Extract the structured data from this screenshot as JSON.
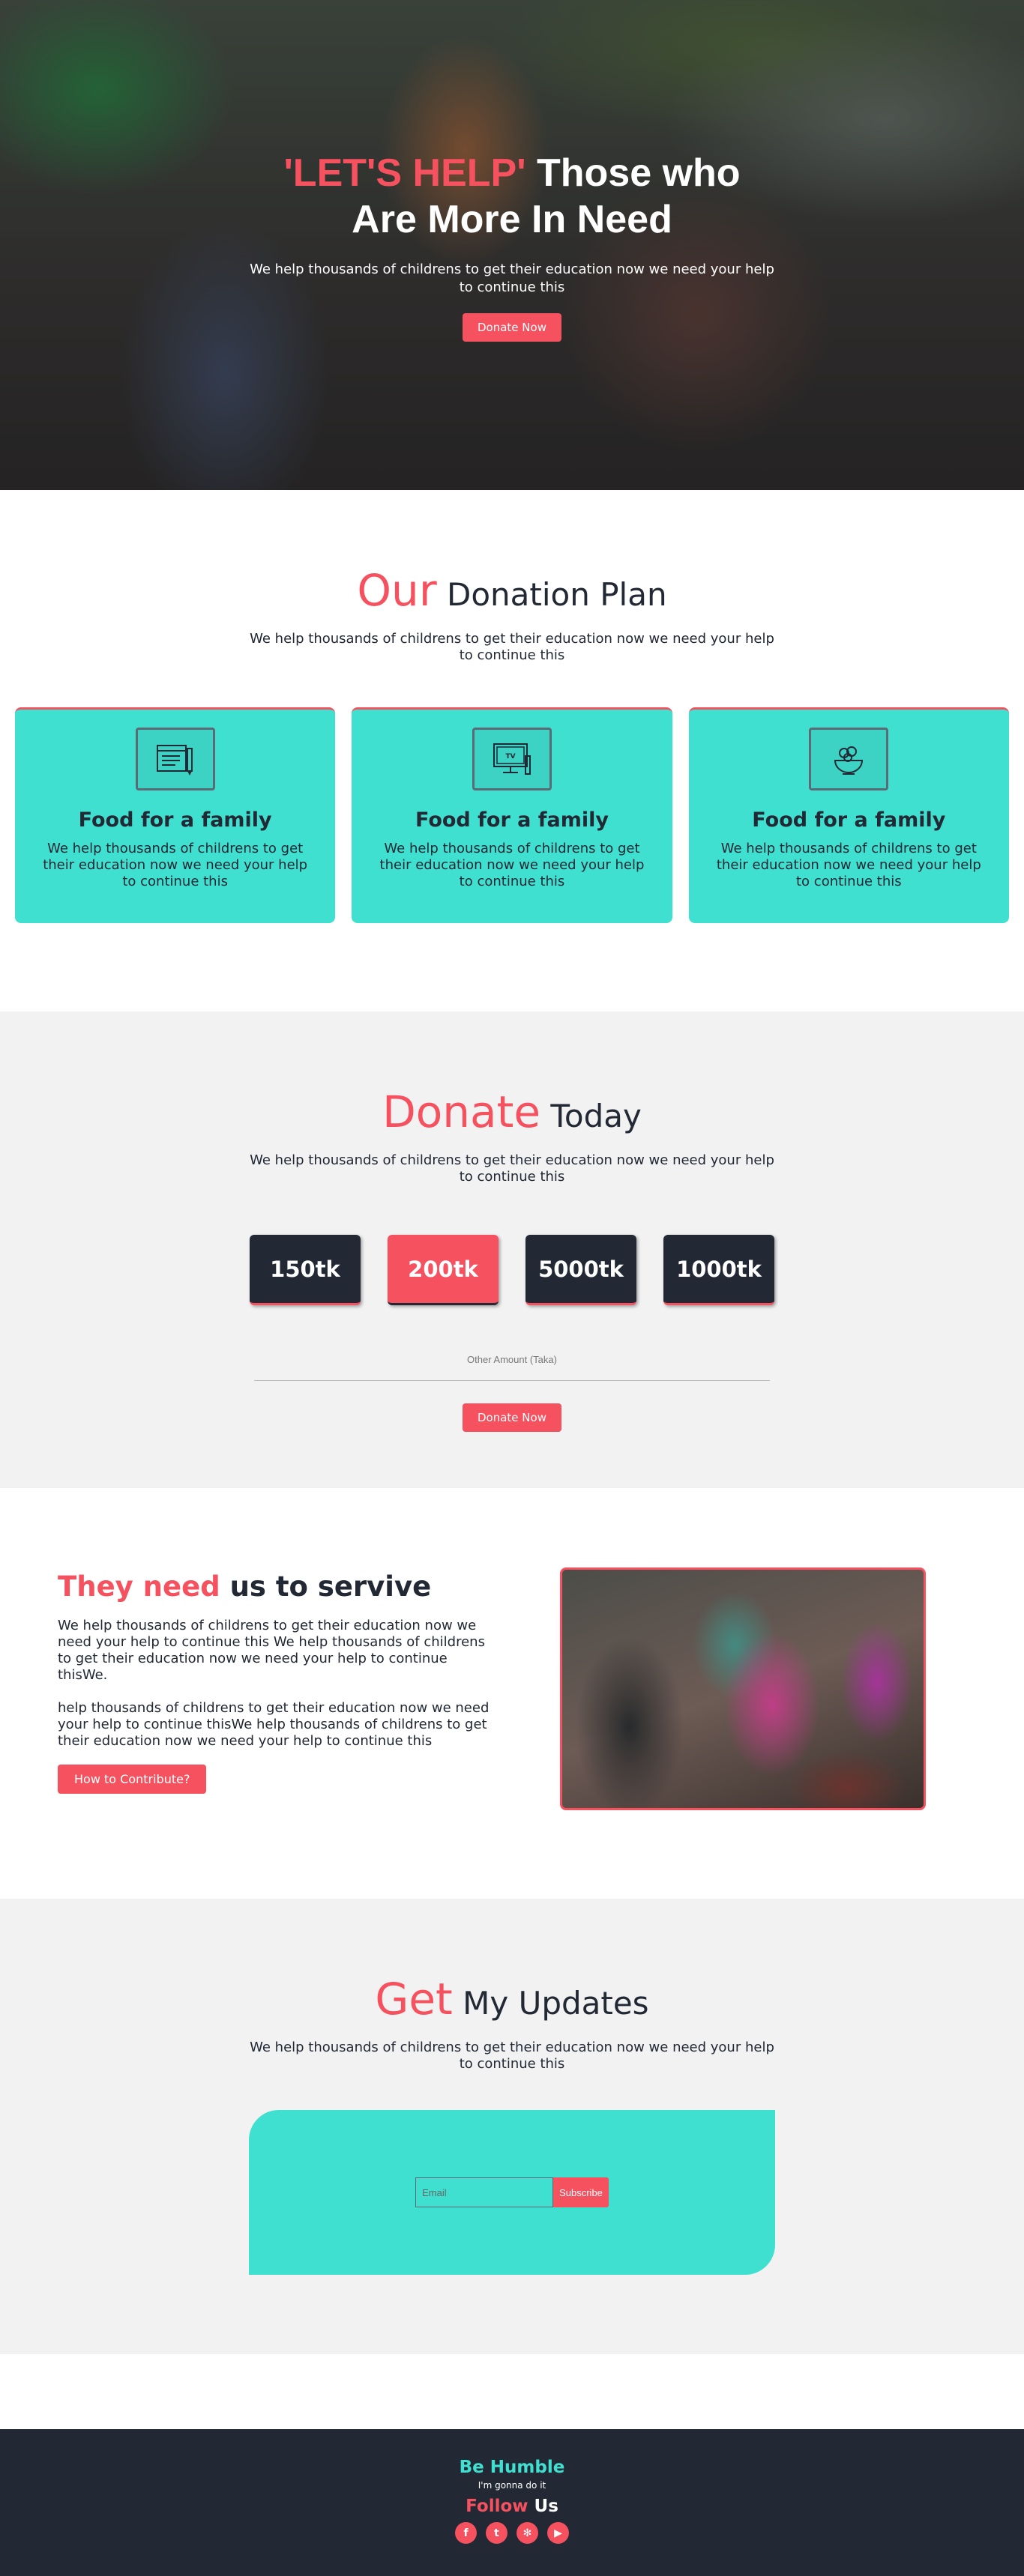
{
  "hero": {
    "title_accent": "'LET'S HELP'",
    "title_rest": " Those who",
    "title_line2": "Are More In Need",
    "subtitle": "We help thousands of childrens to get their education now we need your help to continue this",
    "button": "Donate Now"
  },
  "plan": {
    "title_accent": "Our",
    "title_rest": " Donation Plan",
    "subtitle": "We help thousands of childrens to get their education now we need your help to continue this",
    "cards": [
      {
        "icon": "document-pencil-icon",
        "title": "Food for a family",
        "text": "We help thousands of childrens to get their education now we need your help to continue this"
      },
      {
        "icon": "tv-icon",
        "icon_label": "TV",
        "title": "Food for a family",
        "text": "We help thousands of childrens to get their education now we need your help to continue this"
      },
      {
        "icon": "food-bowl-icon",
        "title": "Food for a family",
        "text": "We help thousands of childrens to get their education now we need your help to continue this"
      }
    ]
  },
  "donate": {
    "title_accent": "Donate",
    "title_rest": " Today",
    "subtitle": "We help thousands of childrens to get their education now we need your help to continue this",
    "amounts": [
      "150tk",
      "200tk",
      "5000tk",
      "1000tk"
    ],
    "selected": "200tk",
    "other_label": "Other Amount (Taka)",
    "button": "Donate Now"
  },
  "survive": {
    "title_accent": "They need",
    "title_rest": " us to servive",
    "para1": "We help thousands of childrens to get their education now we need your help to continue this We help thousands of childrens to get their education now we need your help to continue thisWe.",
    "para2": "help thousands of childrens to get their education now we need your help to continue thisWe help thousands of childrens to get their education now we need your help to continue this",
    "button": "How to Contribute?"
  },
  "updates": {
    "title_accent": "Get",
    "title_rest": " My Updates",
    "subtitle": "We help thousands of childrens to get their education now we need your help to continue this",
    "email_placeholder": "Email",
    "subscribe": "Subscribe"
  },
  "footer": {
    "brand": "Be Humble",
    "tagline": "I'm gonna do it",
    "follow_accent": "Follow",
    "follow_rest": " Us",
    "socials": [
      {
        "icon": "facebook-icon",
        "glyph": "f"
      },
      {
        "icon": "twitter-icon",
        "glyph": "t"
      },
      {
        "icon": "yelp-icon",
        "glyph": "✻"
      },
      {
        "icon": "youtube-icon",
        "glyph": "▶"
      }
    ]
  },
  "colors": {
    "accent": "#f5515f",
    "teal": "#40e0d0",
    "dark": "#222834",
    "light_bg": "#f2f2f2"
  }
}
